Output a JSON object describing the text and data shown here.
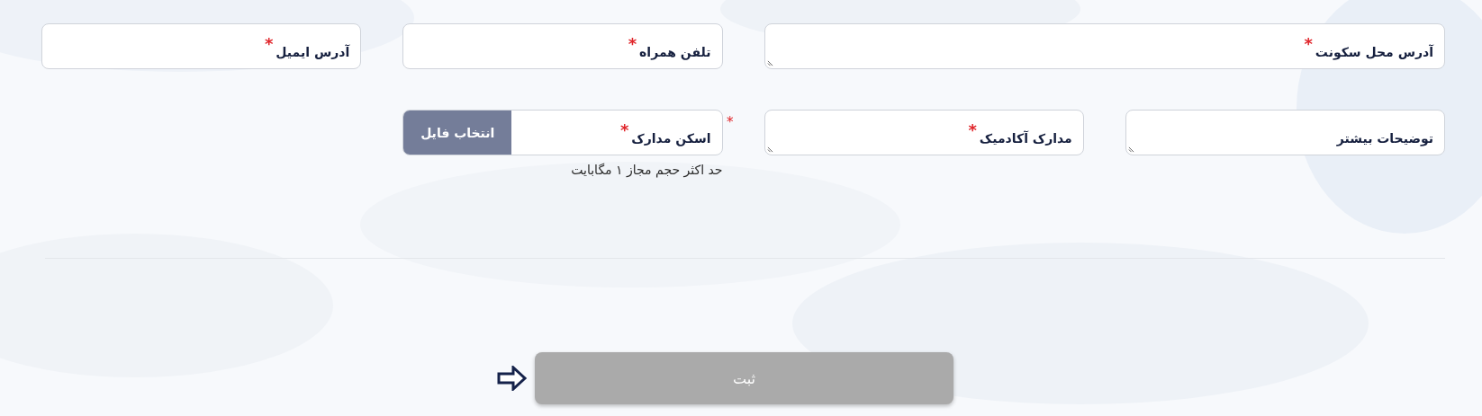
{
  "rows": [
    [
      {
        "kind": "textarea",
        "label": "آدرس محل سکونت",
        "required_mark": "*"
      },
      {
        "kind": "input",
        "label": "تلفن همراه",
        "required_mark": "*"
      },
      {
        "kind": "input",
        "label": "آدرس ایمیل",
        "required_mark": "*"
      }
    ],
    [
      {
        "kind": "textarea",
        "label": "توضیحات بیشتر"
      },
      {
        "kind": "textarea",
        "label": "مدارک آکادمیک",
        "required_mark": "*"
      },
      {
        "kind": "file",
        "label": "اسکن مدارک",
        "required_mark": "*",
        "outer_mark": "*",
        "button": "انتخاب فایل",
        "hint": "حد اکثر حجم مجاز ۱ مگابایت"
      }
    ]
  ],
  "submit": {
    "label": "ثبت",
    "disabled": true
  }
}
